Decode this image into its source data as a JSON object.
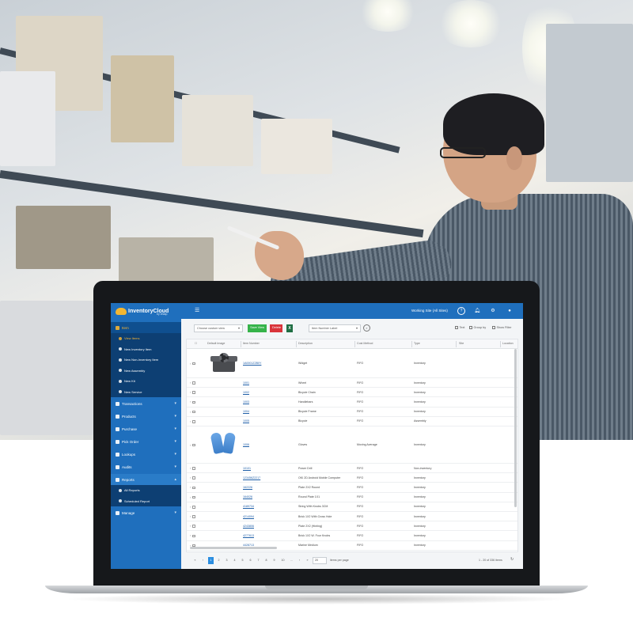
{
  "app": {
    "logo_text": "InventoryCloud",
    "logo_sub": "by Wasp",
    "site_selector": "Working Site (All Sites)",
    "topbar_icons": [
      "help-icon",
      "bell-icon",
      "gear-icon",
      "user-icon"
    ],
    "accent_color": "#1f6fbd",
    "active_color": "#f3b234"
  },
  "sidebar": {
    "items": [
      {
        "label": "Item",
        "icon": "box-icon",
        "selected": true
      },
      {
        "label": "Transactions",
        "icon": "transactions-icon"
      },
      {
        "label": "Products",
        "icon": "products-icon"
      },
      {
        "label": "Purchase",
        "icon": "cart-icon"
      },
      {
        "label": "Pick Order",
        "icon": "pick-icon"
      },
      {
        "label": "Lookups",
        "icon": "search-icon"
      },
      {
        "label": "Audits",
        "icon": "audit-icon"
      },
      {
        "label": "Reports",
        "icon": "chart-icon",
        "selected": true
      },
      {
        "label": "Manage",
        "icon": "manage-icon"
      }
    ],
    "item_subitems": [
      {
        "label": "View Items",
        "selected": true
      },
      {
        "label": "New Inventory Item"
      },
      {
        "label": "New Non-Inventory Item"
      },
      {
        "label": "New Assembly"
      },
      {
        "label": "New Kit"
      },
      {
        "label": "New Service"
      }
    ],
    "report_subitems": [
      {
        "label": "All Reports"
      },
      {
        "label": "Scheduled Report"
      }
    ]
  },
  "toolbar": {
    "view_select": "Choose custom view",
    "save_view": "Save View",
    "delete": "Delete",
    "excel": "X",
    "label_select": "Item Number Label",
    "text_toggle": "Text",
    "group_by": "Group by",
    "show_filter": "Show Filter"
  },
  "table": {
    "columns": [
      "Default Image",
      "Item Number",
      "Description",
      "Cost Method",
      "Type",
      "Site",
      "Location"
    ],
    "rows": [
      {
        "item_number": "1A0001Z2B0Y",
        "description": "Widget",
        "cost_method": "FIFO",
        "type": "Inventory",
        "image": "toolbox"
      },
      {
        "item_number": "1001",
        "description": "Wheel",
        "cost_method": "FIFO",
        "type": "Inventory"
      },
      {
        "item_number": "1002",
        "description": "Bicycle Chain",
        "cost_method": "FIFO",
        "type": "Inventory"
      },
      {
        "item_number": "1003",
        "description": "Handlebars",
        "cost_method": "FIFO",
        "type": "Inventory"
      },
      {
        "item_number": "1004",
        "description": "Bicycle Frame",
        "cost_method": "FIFO",
        "type": "Inventory"
      },
      {
        "item_number": "1005",
        "description": "Bicycle",
        "cost_method": "FIFO",
        "type": "Assembly"
      },
      {
        "item_number": "1006",
        "description": "Gloves",
        "cost_method": "Moving Average",
        "type": "Inventory",
        "image": "gloves"
      },
      {
        "item_number": "10101",
        "description": "Power Drill",
        "cost_method": "FIFO",
        "type": "Non-inventory"
      },
      {
        "item_number": "123456Z2217",
        "description": "OKI 2D Android Mobile Computer",
        "cost_method": "FIFO",
        "type": "Inventory"
      },
      {
        "item_number": "162226",
        "description": "Plate 2X2 Round",
        "cost_method": "FIFO",
        "type": "Inventory"
      },
      {
        "item_number": "164026",
        "description": "Round Plate 1X1",
        "cost_method": "FIFO",
        "type": "Inventory"
      },
      {
        "item_number": "4189734",
        "description": "String With Knobs 3CM",
        "cost_method": "FIFO",
        "type": "Inventory"
      },
      {
        "item_number": "4214094",
        "description": "Brick 1X2 With Cross Hole",
        "cost_method": "FIFO",
        "type": "Inventory"
      },
      {
        "item_number": "4243806",
        "description": "Plate 2X2 (Hinting)",
        "cost_method": "FIFO",
        "type": "Inventory"
      },
      {
        "item_number": "4277613",
        "description": "Brick 1X2 W. Four Knobs",
        "cost_method": "FIFO",
        "type": "Inventory"
      },
      {
        "item_number": "4428713",
        "description": "Marine Medium",
        "cost_method": "FIFO",
        "type": "Inventory"
      }
    ]
  },
  "pager": {
    "pages": [
      "1",
      "2",
      "3",
      "4",
      "5",
      "6",
      "7",
      "8",
      "9",
      "10"
    ],
    "current_page": "1",
    "first": "«",
    "prev": "‹",
    "ellipsis": "...",
    "next": "›",
    "last": "»",
    "page_size": "20",
    "items_per_page": "items per page",
    "summary": "1 - 20 of 336 items"
  }
}
